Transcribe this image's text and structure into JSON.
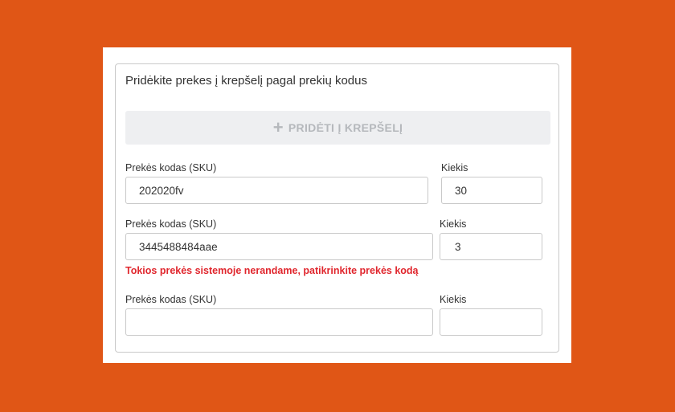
{
  "form": {
    "title": "Pridėkite prekes į krepšelį pagal prekių kodus",
    "add_button_label": "PRIDĖTI Į KREPŠELĮ",
    "add_button_icon": "plus-icon",
    "rows": [
      {
        "sku_label": "Prekės kodas (SKU)",
        "sku_value": "202020fv",
        "qty_label": "Kiekis",
        "qty_value": "30"
      },
      {
        "sku_label": "Prekės kodas (SKU)",
        "sku_value": "3445488484aae",
        "qty_label": "Kiekis",
        "qty_value": "3",
        "error": "Tokios prekės sistemoje nerandame, patikrinkite prekės kodą"
      },
      {
        "sku_label": "Prekės kodas (SKU)",
        "sku_value": "",
        "qty_label": "Kiekis",
        "qty_value": ""
      }
    ]
  },
  "colors": {
    "background": "#e05616",
    "error": "#e0262d",
    "button_bg": "#eeeff1",
    "button_text": "#b5b8bc"
  }
}
